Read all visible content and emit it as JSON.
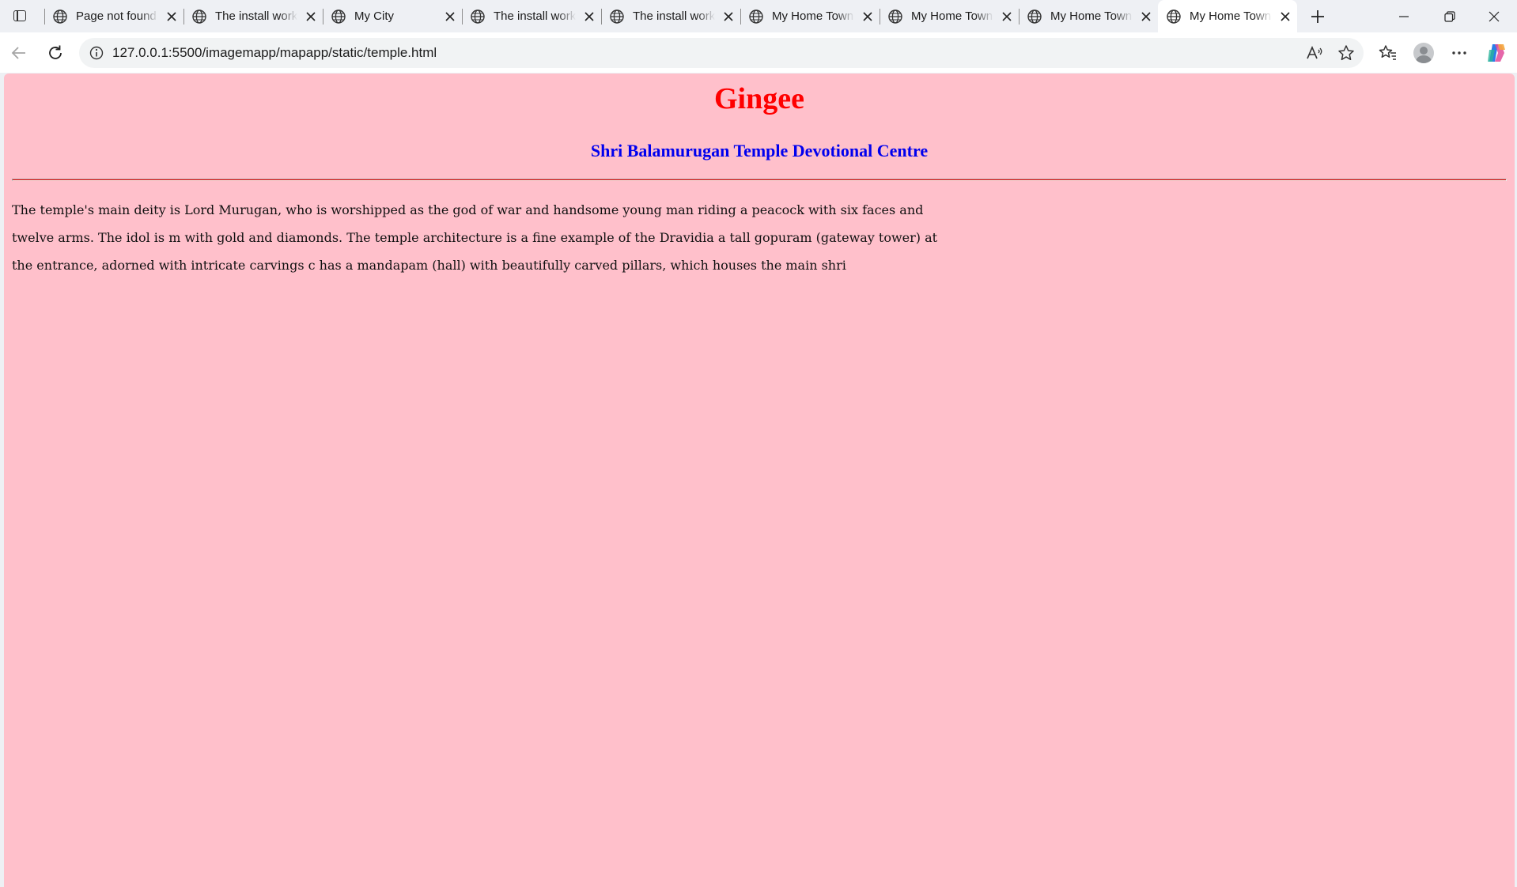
{
  "browser": {
    "tabs": [
      {
        "title": "Page not found",
        "active": false
      },
      {
        "title": "The install worked",
        "active": false
      },
      {
        "title": "My City",
        "active": false
      },
      {
        "title": "The install worked",
        "active": false
      },
      {
        "title": "The install worked",
        "active": false
      },
      {
        "title": "My Home Town",
        "active": false
      },
      {
        "title": "My Home Town",
        "active": false
      },
      {
        "title": "My Home Town",
        "active": false
      },
      {
        "title": "My Home Town",
        "active": true
      }
    ],
    "url": "127.0.0.1:5500/imagemapp/mapapp/static/temple.html"
  },
  "page": {
    "title": "Gingee",
    "subtitle": "Shri Balamurugan Temple Devotional Centre",
    "paragraph_lines": [
      "The temple's main deity is Lord Murugan, who is worshipped as the god of war and handsome young man riding a peacock with six faces and",
      "twelve arms. The idol is m with gold and diamonds. The temple architecture is a fine example of the Dravidia a tall gopuram (gateway tower) at",
      "the entrance, adorned with intricate carvings c has a mandapam (hall) with beautifully carved pillars, which houses the main shri"
    ]
  },
  "colors": {
    "page_background": "#ffc0cb",
    "title": "#ff0000",
    "subtitle": "#0000ee",
    "rule": "#ff0000"
  }
}
